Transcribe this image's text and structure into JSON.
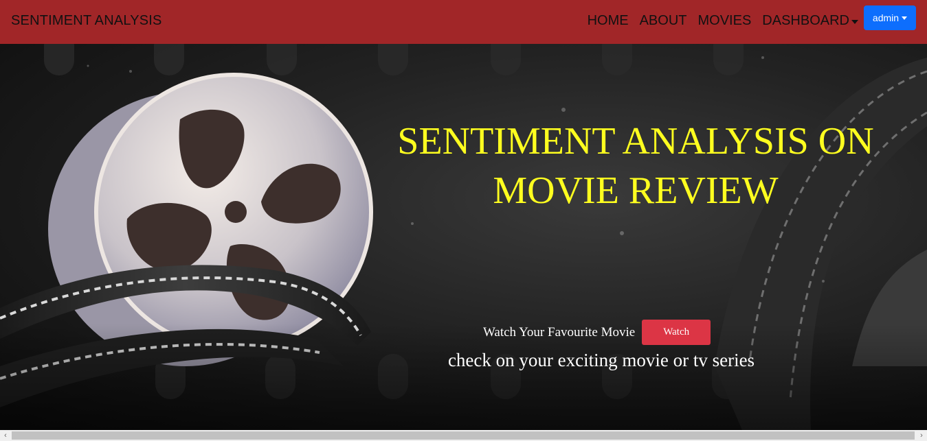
{
  "navbar": {
    "brand": "SENTIMENT ANALYSIS",
    "links": [
      "HOME",
      "ABOUT",
      "MOVIES",
      "DASHBOARD"
    ],
    "user_button": "admin",
    "background": "#a12628",
    "user_button_color": "#0d6efd"
  },
  "hero": {
    "headline_line1": "SENTIMENT ANALYSIS ON",
    "headline_line2": "MOVIE REVIEW",
    "watch_text": "Watch Your Favourite Movie",
    "watch_button": "Watch",
    "subline": "check on your exciting movie or tv series",
    "headline_color": "#ffff1f",
    "button_color": "#dc3545"
  },
  "scrollbar": {
    "left_arrow": "‹",
    "right_arrow": "›"
  }
}
